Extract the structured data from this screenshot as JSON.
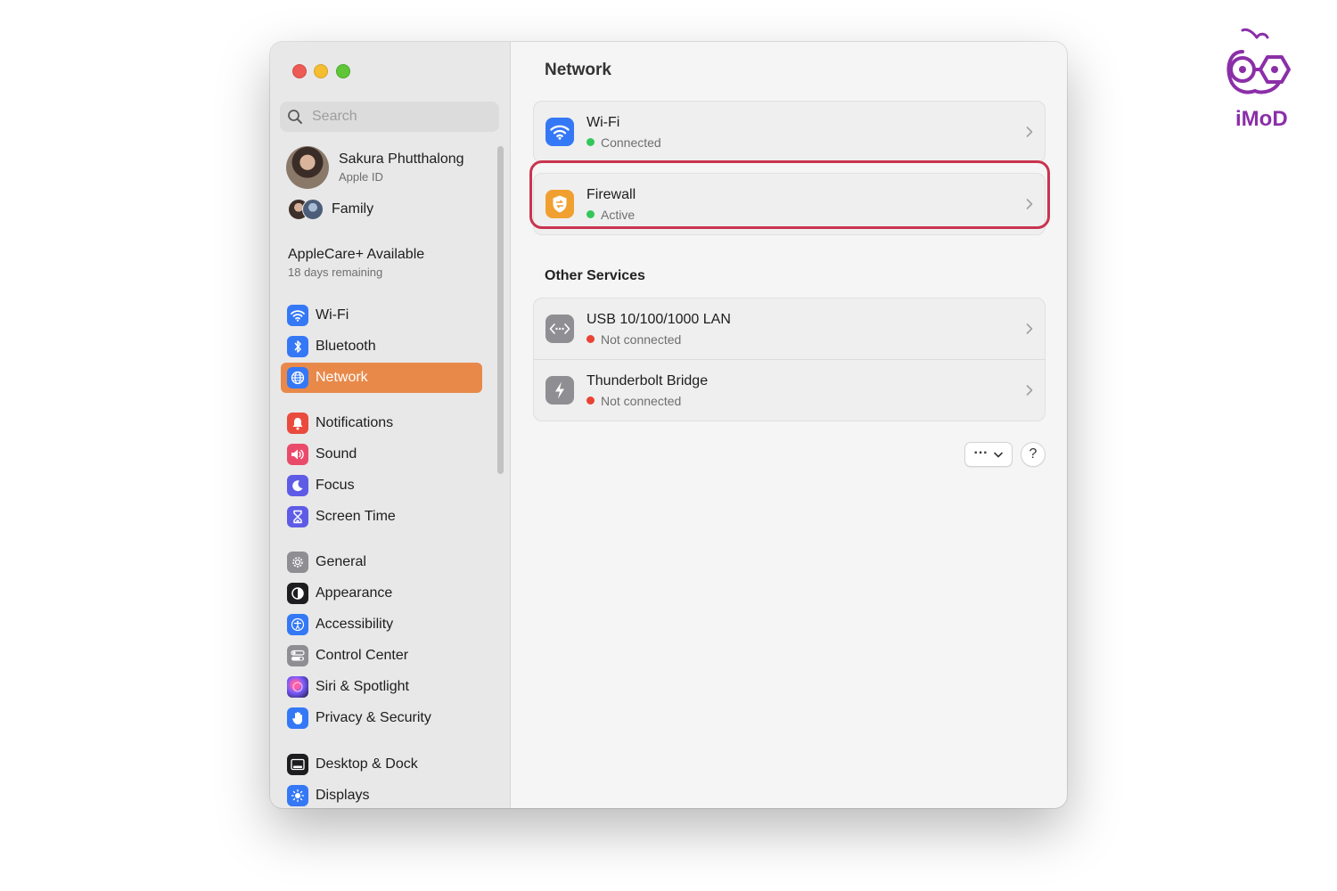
{
  "window": {
    "traffic_lights": [
      "close",
      "minimize",
      "zoom"
    ]
  },
  "sidebar": {
    "search": {
      "placeholder": "Search",
      "value": ""
    },
    "profile": {
      "name": "Sakura Phutthalong",
      "subtitle": "Apple ID"
    },
    "family": {
      "label": "Family"
    },
    "applecare": {
      "title": "AppleCare+ Available",
      "subtitle": "18 days remaining"
    },
    "items": [
      {
        "label": "Wi-Fi",
        "icon": "wifi-icon",
        "color": "#3478f6",
        "selected": false
      },
      {
        "label": "Bluetooth",
        "icon": "bluetooth-icon",
        "color": "#3478f6",
        "selected": false
      },
      {
        "label": "Network",
        "icon": "globe-icon",
        "color": "#3478f6",
        "selected": true
      },
      {
        "label": "Notifications",
        "icon": "bell-icon",
        "color": "#ea4a3e",
        "selected": false
      },
      {
        "label": "Sound",
        "icon": "speaker-icon",
        "color": "#ea4a6a",
        "selected": false
      },
      {
        "label": "Focus",
        "icon": "moon-icon",
        "color": "#5e5ce6",
        "selected": false
      },
      {
        "label": "Screen Time",
        "icon": "hourglass-icon",
        "color": "#5e5ce6",
        "selected": false
      },
      {
        "label": "General",
        "icon": "gear-icon",
        "color": "#8e8e93",
        "selected": false
      },
      {
        "label": "Appearance",
        "icon": "appearance-icon",
        "color": "#1d1d1f",
        "selected": false
      },
      {
        "label": "Accessibility",
        "icon": "accessibility-icon",
        "color": "#3478f6",
        "selected": false
      },
      {
        "label": "Control Center",
        "icon": "toggles-icon",
        "color": "#8e8e93",
        "selected": false
      },
      {
        "label": "Siri & Spotlight",
        "icon": "siri-icon",
        "color": "#3a3a8a",
        "selected": false
      },
      {
        "label": "Privacy & Security",
        "icon": "hand-icon",
        "color": "#3478f6",
        "selected": false
      },
      {
        "label": "Desktop & Dock",
        "icon": "dock-icon",
        "color": "#1d1d1f",
        "selected": false
      },
      {
        "label": "Displays",
        "icon": "sun-icon",
        "color": "#3478f6",
        "selected": false
      }
    ]
  },
  "main": {
    "title": "Network",
    "services": [
      {
        "title": "Wi-Fi",
        "status": "Connected",
        "status_color": "#34c759",
        "icon": "wifi-icon",
        "icon_color": "#3478f6"
      },
      {
        "title": "Firewall",
        "status": "Active",
        "status_color": "#34c759",
        "icon": "firewall-shield-icon",
        "icon_color": "#f0a030"
      }
    ],
    "other_services_title": "Other Services",
    "other_services": [
      {
        "title": "USB 10/100/1000 LAN",
        "status": "Not connected",
        "status_color": "#ea4335",
        "icon": "ethernet-icon",
        "icon_color": "#8e8e93"
      },
      {
        "title": "Thunderbolt Bridge",
        "status": "Not connected",
        "status_color": "#ea4335",
        "icon": "thunderbolt-icon",
        "icon_color": "#8e8e93"
      }
    ],
    "more_button": "···",
    "help_button": "?"
  },
  "watermark": {
    "text": "iMoD",
    "color": "#8b2fa8"
  }
}
